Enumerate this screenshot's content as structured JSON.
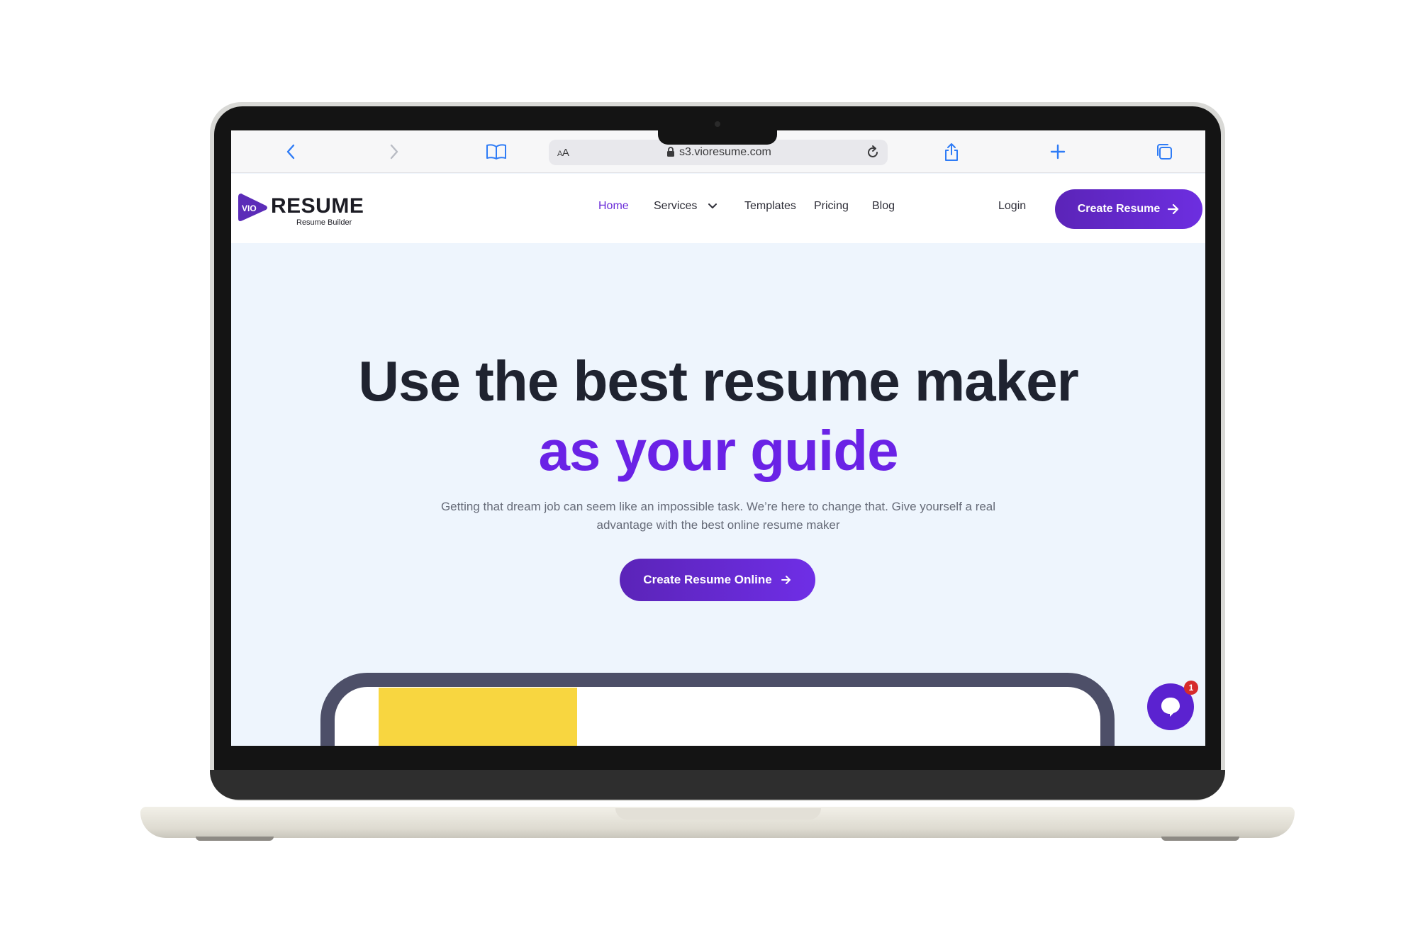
{
  "browser": {
    "url_text": "s3.vioresume.com",
    "reader_label_big": "A",
    "reader_label_small": "A"
  },
  "site": {
    "logo": {
      "badge": "VIO",
      "name": "RESUME",
      "tagline": "Resume Builder"
    },
    "nav": {
      "items": [
        {
          "label": "Home",
          "active": true
        },
        {
          "label": "Services",
          "has_dropdown": true
        },
        {
          "label": "Templates"
        },
        {
          "label": "Pricing"
        },
        {
          "label": "Blog"
        }
      ],
      "login_label": "Login",
      "cta_label": "Create Resume"
    },
    "hero": {
      "title_line1": "Use the best resume maker",
      "title_line2": "as your guide",
      "subtitle_line1": "Getting that dream job can seem like an impossible task. We’re here to change that. Give yourself a real",
      "subtitle_line2": "advantage with the best online resume maker",
      "cta_label": "Create Resume Online"
    },
    "chat": {
      "badge_count": "1"
    }
  },
  "colors": {
    "accent": "#6a22e6",
    "button_gradient_start": "#5b24b8",
    "hero_background": "#eef5fd",
    "title_dark": "#1f2330",
    "badge_red": "#d62b2b",
    "device_yellow": "#f8d640"
  },
  "icons": {
    "back": "chevron-left-icon",
    "forward": "chevron-right-icon",
    "bookmarks": "book-icon",
    "lock": "lock-icon",
    "reload": "reload-icon",
    "share": "share-icon",
    "new_tab": "plus-icon",
    "tabs": "tabs-icon",
    "arrow": "arrow-right-icon",
    "chat": "chat-bubble-icon"
  }
}
